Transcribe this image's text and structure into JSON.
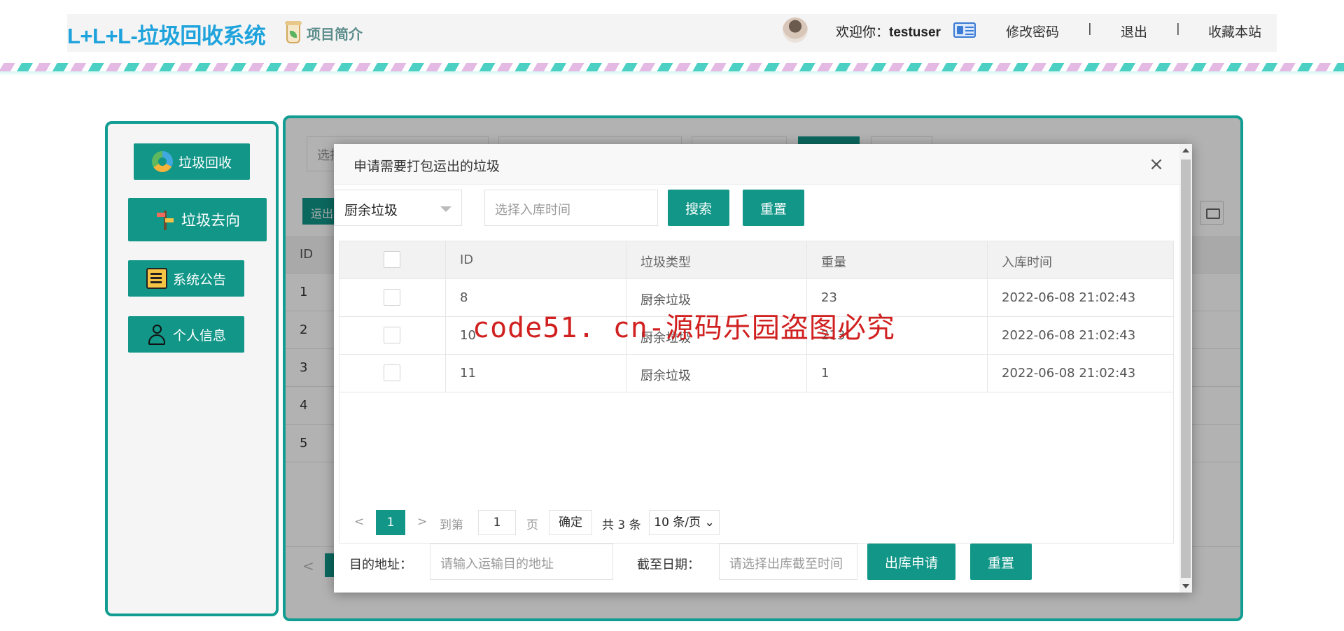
{
  "header": {
    "logo": "L+L+L-垃圾回收系统",
    "intro_label": "项目简介",
    "welcome_prefix": "欢迎你：",
    "username": "testuser",
    "links": [
      "修改密码",
      "退出",
      "收藏本站"
    ],
    "separator": "|"
  },
  "sidebar": {
    "items": [
      {
        "label": "垃圾回收",
        "icon": "recycle-icon"
      },
      {
        "label": "垃圾去向",
        "icon": "signpost-icon"
      },
      {
        "label": "系统公告",
        "icon": "notice-board-icon"
      },
      {
        "label": "个人信息",
        "icon": "user-icon"
      }
    ]
  },
  "background_page": {
    "search_placeholder": "选择",
    "toolbar_button": "运出",
    "id_header": "ID",
    "rows": [
      "1",
      "2",
      "3",
      "4",
      "5"
    ]
  },
  "modal": {
    "title": "申请需要打包运出的垃圾",
    "close": "×",
    "filter": {
      "type_select": "厨余垃圾",
      "date_placeholder": "选择入库时间",
      "search_button": "搜索",
      "reset_button": "重置"
    },
    "table": {
      "columns": [
        "ID",
        "垃圾类型",
        "重量",
        "入库时间"
      ],
      "rows": [
        {
          "id": "8",
          "type": "厨余垃圾",
          "weight": "23",
          "time": "2022-06-08 21:02:43"
        },
        {
          "id": "10",
          "type": "厨余垃圾",
          "weight": "213",
          "time": "2022-06-08 21:02:43"
        },
        {
          "id": "11",
          "type": "厨余垃圾",
          "weight": "1",
          "time": "2022-06-08 21:02:43"
        }
      ]
    },
    "pager": {
      "prev": "<",
      "current": "1",
      "next": ">",
      "goto_label": "到第",
      "goto_value": "1",
      "page_unit": "页",
      "confirm": "确定",
      "total": "共 3 条",
      "per_page": "10 条/页"
    },
    "form": {
      "dest_label": "目的地址：",
      "dest_placeholder": "请输入运输目的地址",
      "deadline_label": "截至日期：",
      "deadline_placeholder": "请选择出库截至时间",
      "submit_button": "出库申请",
      "reset_button": "重置"
    }
  },
  "watermark": "code51. cn-源码乐园盗图必究",
  "colors": {
    "primary": "#119688",
    "border": "#119d91",
    "logo": "#1ea3dc",
    "watermark": "#d12020"
  }
}
